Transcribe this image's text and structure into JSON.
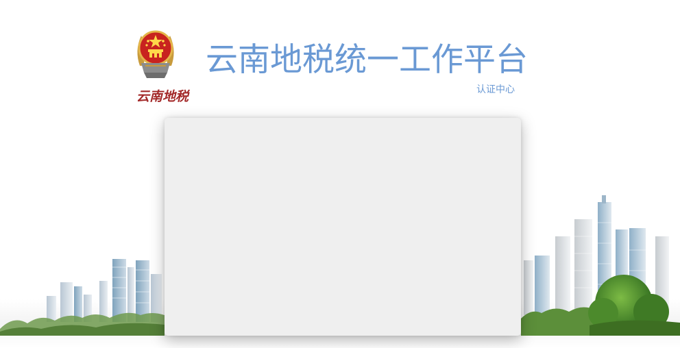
{
  "header": {
    "emblem_icon": "national-tax-emblem-icon",
    "brand_script": "云南地税",
    "title": "云南地税统一工作平台",
    "subtitle": "认证中心"
  },
  "colors": {
    "title_blue": "#6a99d4",
    "brand_red": "#a32a2a",
    "card_bg": "#efefef"
  },
  "decor": {
    "left_illustration": "city-skyline",
    "right_illustration": "city-skyline-with-trees"
  }
}
